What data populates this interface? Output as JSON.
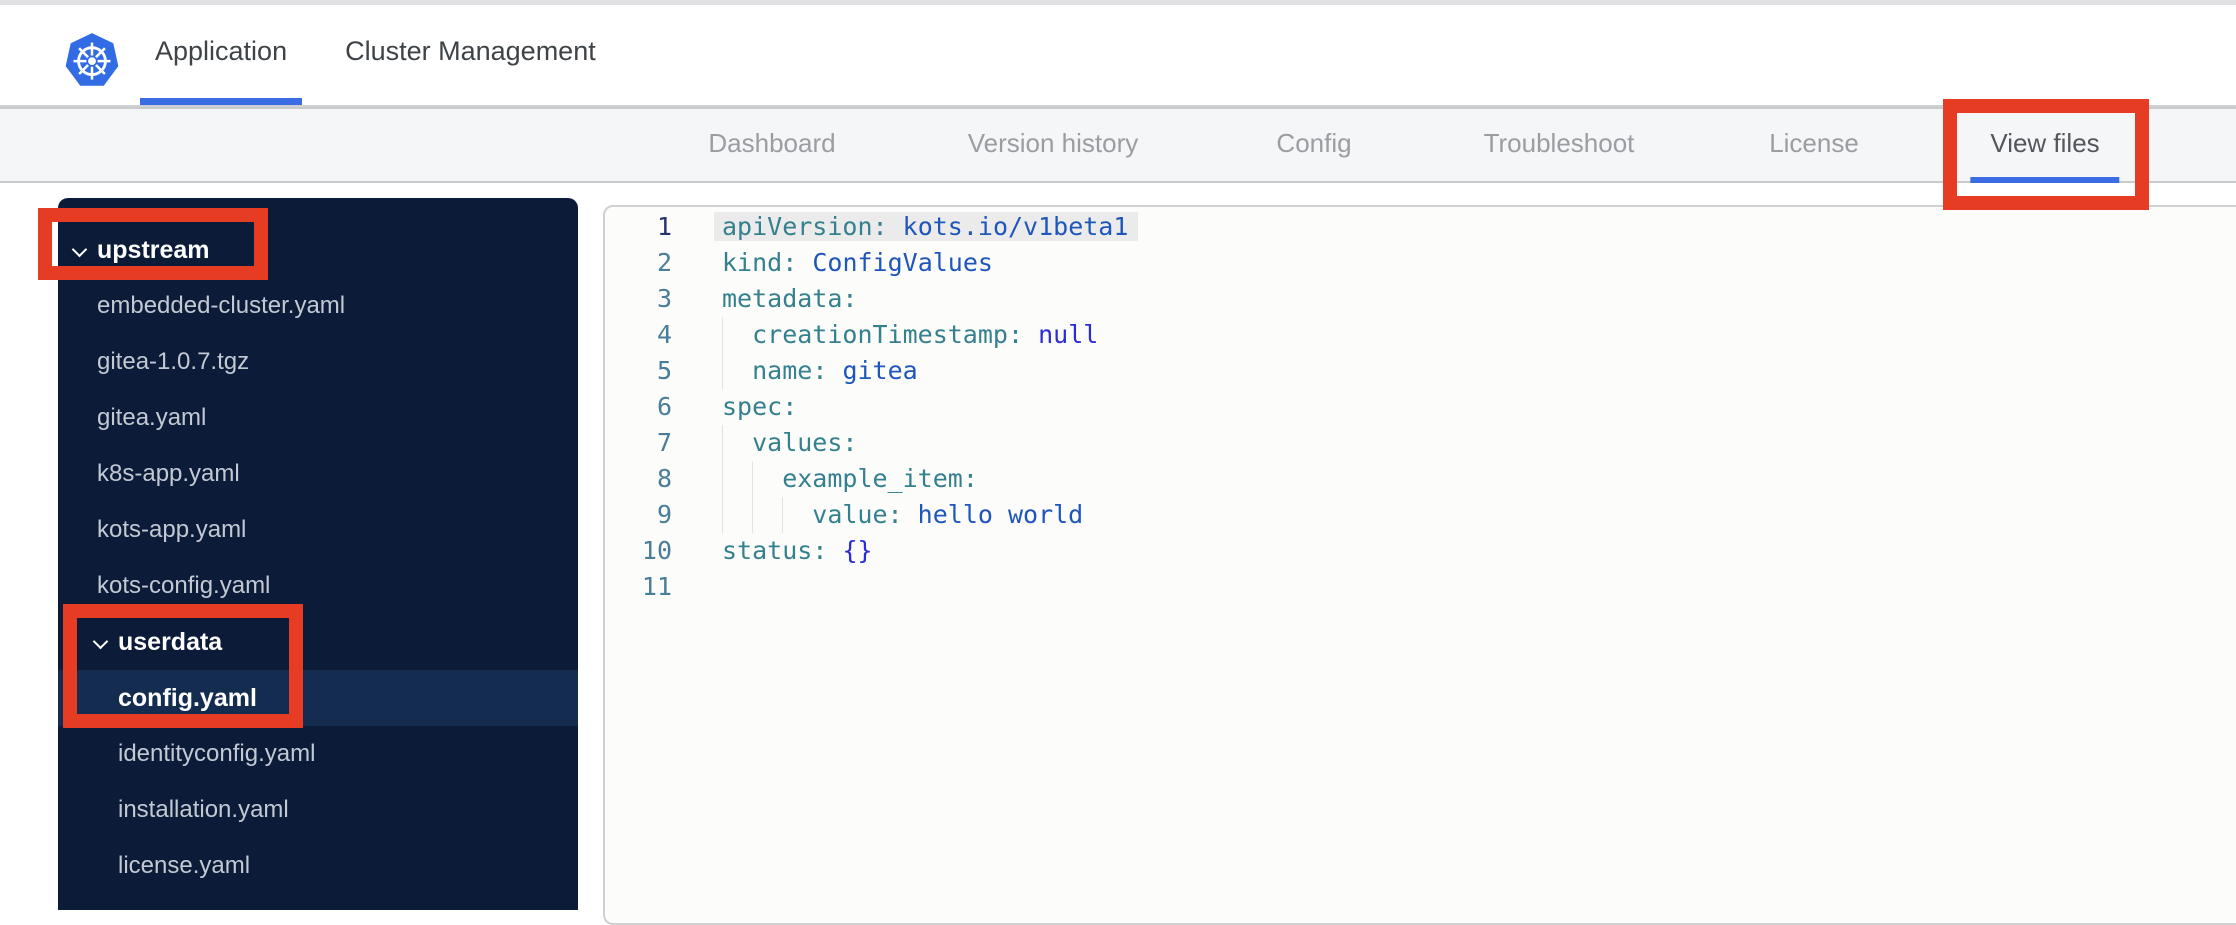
{
  "header": {
    "brand_icon": "kubernetes-logo",
    "brand_color": "#326CE5",
    "tabs": [
      {
        "label": "Application",
        "active": true
      },
      {
        "label": "Cluster Management",
        "active": false
      }
    ]
  },
  "subnav": {
    "items": [
      {
        "label": "Dashboard",
        "active": false
      },
      {
        "label": "Version history",
        "active": false
      },
      {
        "label": "Config",
        "active": false
      },
      {
        "label": "Troubleshoot",
        "active": false
      },
      {
        "label": "License",
        "active": false
      },
      {
        "label": "View files",
        "active": true
      }
    ],
    "active_underline_color": "#3b6ce4"
  },
  "file_tree": {
    "items": [
      {
        "type": "folder",
        "name": "upstream",
        "level": 0,
        "expanded": true
      },
      {
        "type": "file",
        "name": "embedded-cluster.yaml",
        "level": 1
      },
      {
        "type": "file",
        "name": "gitea-1.0.7.tgz",
        "level": 1
      },
      {
        "type": "file",
        "name": "gitea.yaml",
        "level": 1
      },
      {
        "type": "file",
        "name": "k8s-app.yaml",
        "level": 1
      },
      {
        "type": "file",
        "name": "kots-app.yaml",
        "level": 1
      },
      {
        "type": "file",
        "name": "kots-config.yaml",
        "level": 1
      },
      {
        "type": "folder",
        "name": "userdata",
        "level": 1,
        "expanded": true
      },
      {
        "type": "file",
        "name": "config.yaml",
        "level": 2,
        "selected": true
      },
      {
        "type": "file",
        "name": "identityconfig.yaml",
        "level": 2
      },
      {
        "type": "file",
        "name": "installation.yaml",
        "level": 2
      },
      {
        "type": "file",
        "name": "license.yaml",
        "level": 2
      }
    ],
    "background": "#0c1b38",
    "selected_row_background": "#132c4f"
  },
  "editor": {
    "language": "yaml",
    "lines": [
      {
        "num": 1,
        "indent": 0,
        "key": "apiVersion",
        "value": "kots.io/v1beta1",
        "value_type": "string",
        "highlighted": true
      },
      {
        "num": 2,
        "indent": 0,
        "key": "kind",
        "value": "ConfigValues",
        "value_type": "string"
      },
      {
        "num": 3,
        "indent": 0,
        "key": "metadata",
        "value": "",
        "value_type": "none"
      },
      {
        "num": 4,
        "indent": 1,
        "key": "creationTimestamp",
        "value": "null",
        "value_type": "literal"
      },
      {
        "num": 5,
        "indent": 1,
        "key": "name",
        "value": "gitea",
        "value_type": "string"
      },
      {
        "num": 6,
        "indent": 0,
        "key": "spec",
        "value": "",
        "value_type": "none"
      },
      {
        "num": 7,
        "indent": 1,
        "key": "values",
        "value": "",
        "value_type": "none"
      },
      {
        "num": 8,
        "indent": 2,
        "key": "example_item",
        "value": "",
        "value_type": "none"
      },
      {
        "num": 9,
        "indent": 3,
        "key": "value",
        "value": "hello world",
        "value_type": "string"
      },
      {
        "num": 10,
        "indent": 0,
        "key": "status",
        "value": "{}",
        "value_type": "literal"
      },
      {
        "num": 11,
        "indent": 0,
        "key": "",
        "value": "",
        "value_type": "empty"
      }
    ],
    "syntax_colors": {
      "key": "#35808f",
      "string_value": "#1f56bb",
      "literal_value": "#2a2cd8"
    }
  },
  "annotations": {
    "color": "#e63c24",
    "boxes": [
      "upstream-folder",
      "userdata-config-yaml",
      "view-files-tab"
    ]
  }
}
